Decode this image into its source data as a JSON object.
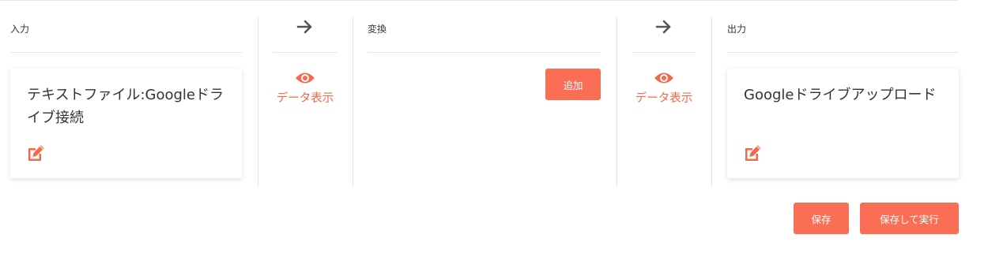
{
  "columns": {
    "input": {
      "label": "入力",
      "card_title": "テキストファイル:Googleドライブ接続"
    },
    "transform": {
      "label": "変換",
      "add_button": "追加"
    },
    "output": {
      "label": "出力",
      "card_title": "Googleドライブアップロード"
    }
  },
  "connectors": {
    "view_label": "データ表示"
  },
  "actions": {
    "save_label": "保存",
    "save_and_run_label": "保存して実行"
  },
  "colors": {
    "accent": "#fa6e55",
    "accent_text": "#f26a4b",
    "arrow": "#555555",
    "divider": "#e4e4e4"
  },
  "icons": {
    "arrow": "arrow-right-icon",
    "view": "eye-icon",
    "edit": "edit-icon"
  }
}
